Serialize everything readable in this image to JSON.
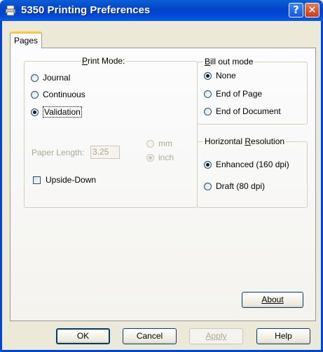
{
  "window": {
    "title": "5350 Printing Preferences",
    "help_button": "?",
    "close_button": "✕"
  },
  "tabs": [
    {
      "label": "Pages"
    }
  ],
  "print_mode": {
    "title": "Print Mode:",
    "options": [
      {
        "label": "Journal",
        "checked": false
      },
      {
        "label": "Continuous",
        "checked": false
      },
      {
        "label": "Validation",
        "checked": true
      }
    ],
    "paper_length_label": "Paper Length:",
    "paper_length_value": "3.25",
    "units": [
      {
        "label": "mm",
        "checked": false
      },
      {
        "label": "inch",
        "checked": true
      }
    ],
    "upside_down_label": "Upside-Down",
    "upside_down_checked": false
  },
  "bill_out_mode": {
    "title": "Bill out mode",
    "options": [
      {
        "label": "None",
        "checked": true
      },
      {
        "label": "End of Page",
        "checked": false
      },
      {
        "label": "End of Document",
        "checked": false
      }
    ]
  },
  "horizontal_resolution": {
    "title": "Horizontal Resolution",
    "options": [
      {
        "label": "Enhanced (160 dpi)",
        "checked": true
      },
      {
        "label": "Draft (80 dpi)",
        "checked": false
      }
    ]
  },
  "buttons": {
    "about": "About",
    "ok": "OK",
    "cancel": "Cancel",
    "apply": "Apply",
    "help": "Help"
  }
}
